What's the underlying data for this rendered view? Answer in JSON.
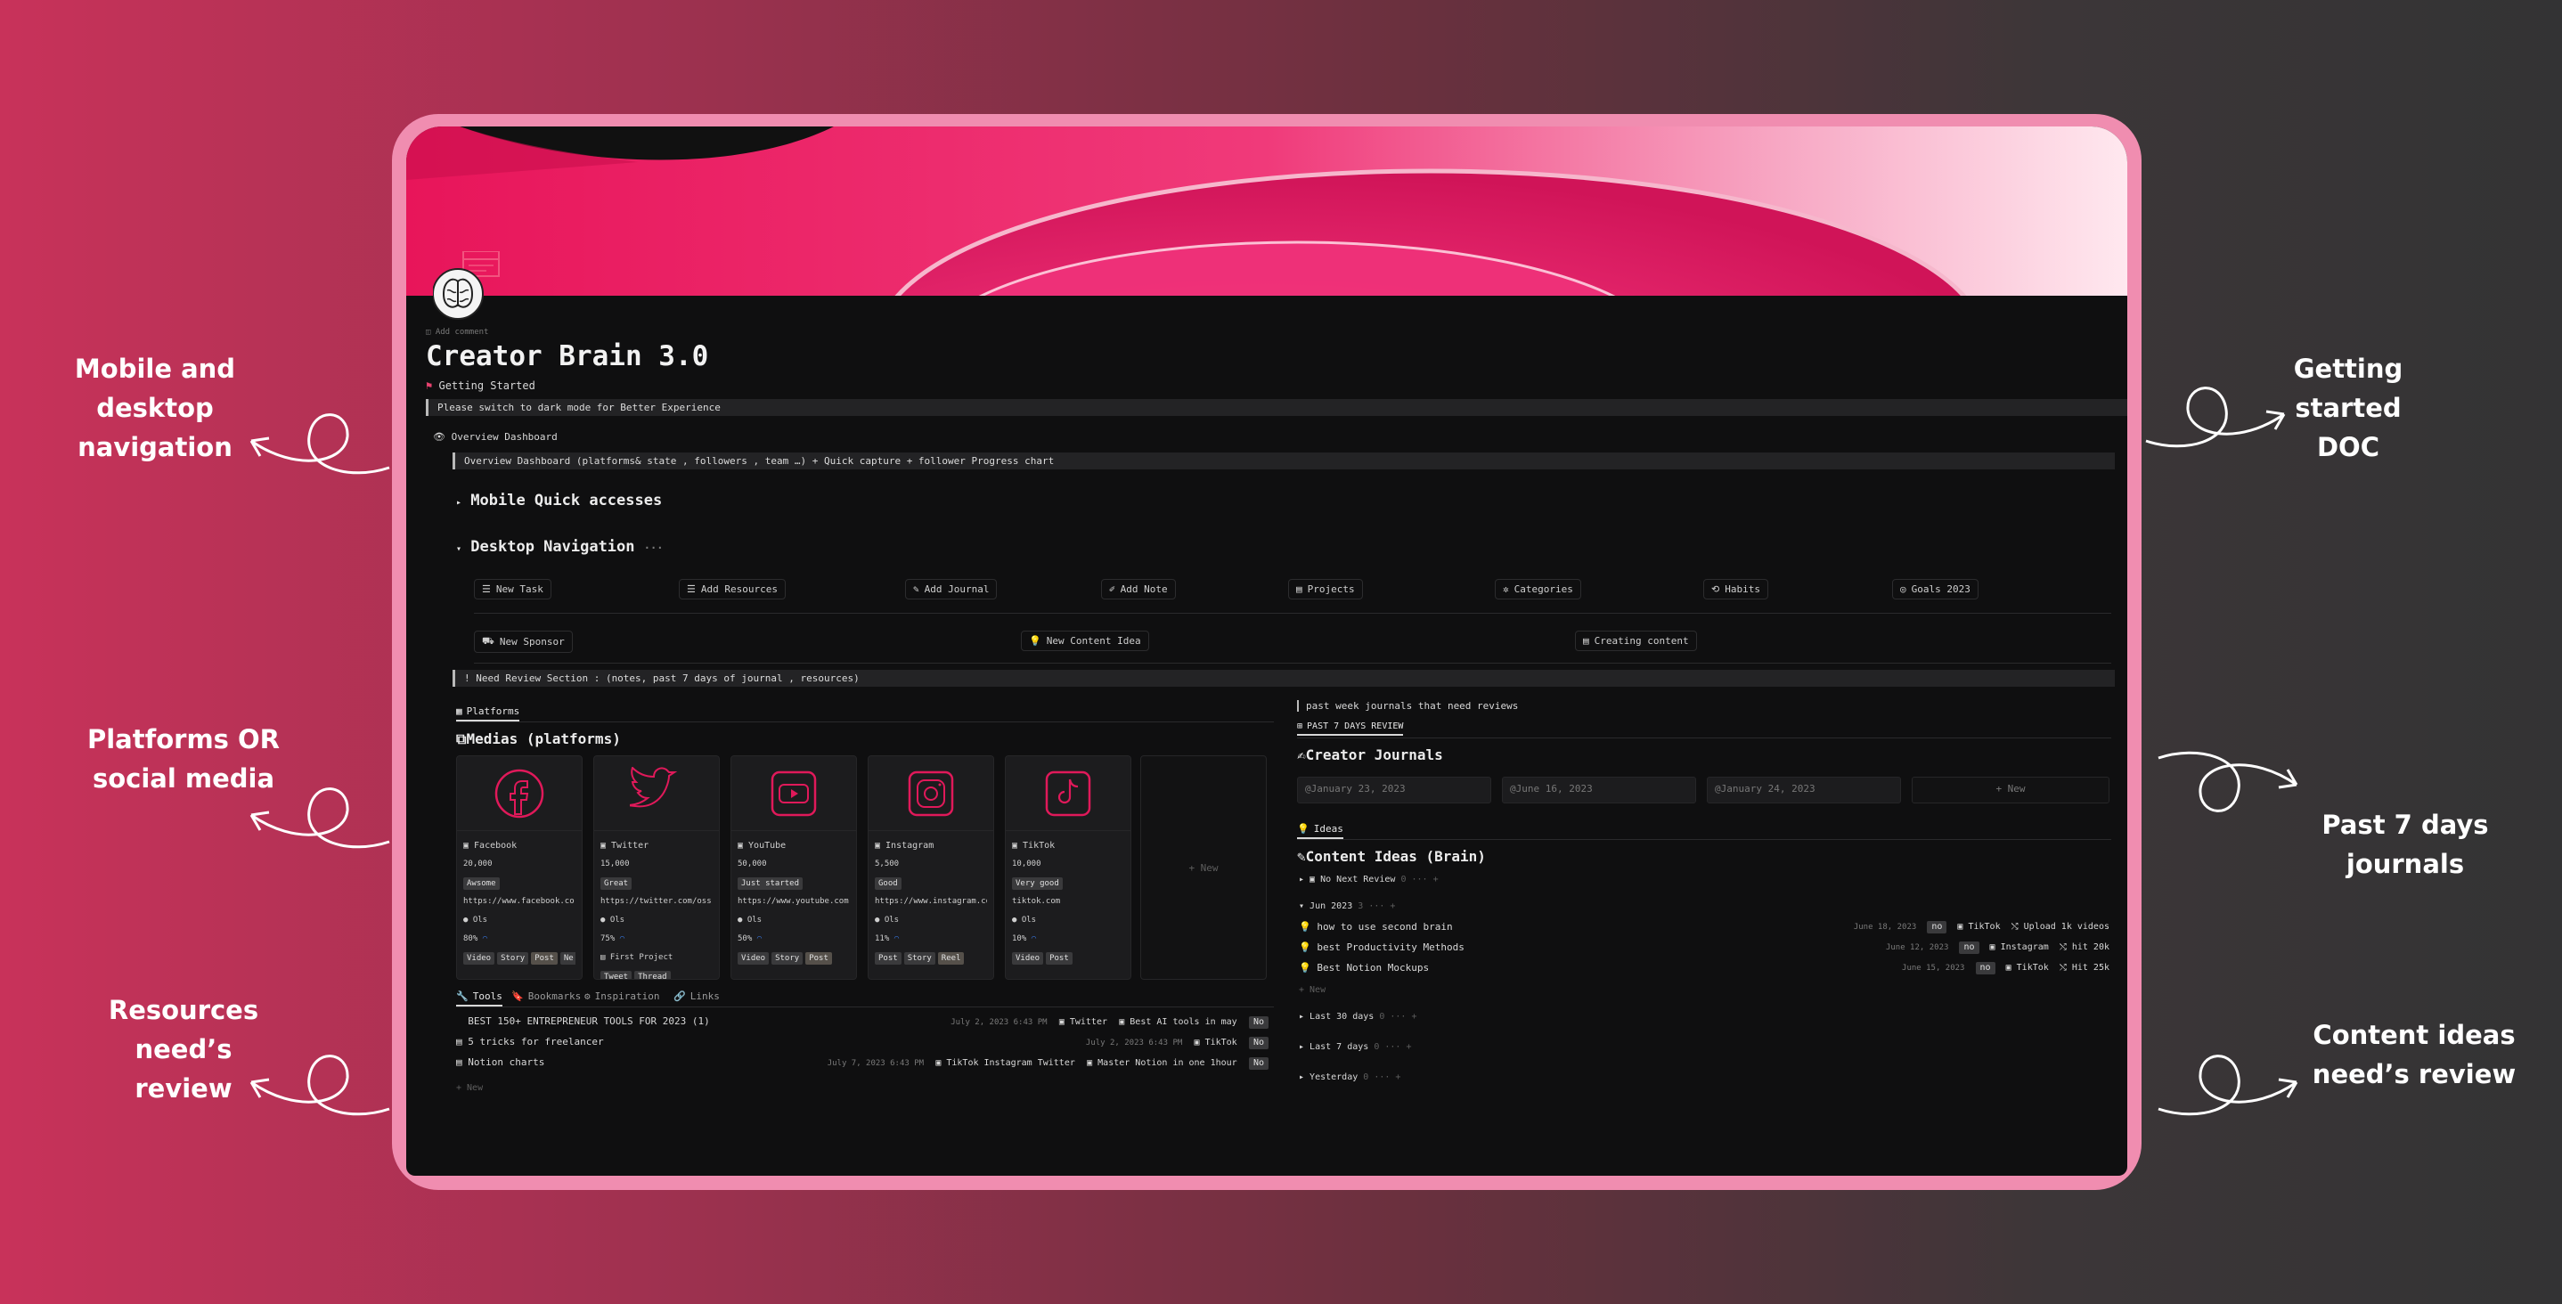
{
  "callouts": {
    "left": [
      "Mobile and\ndesktop\nnavigation",
      "Platforms OR\nsocial media",
      "Resources\nneed’s review"
    ],
    "right": [
      "Getting started\nDOC",
      "Past 7 days\njournals",
      "Content ideas\nneed’s review"
    ]
  },
  "page": {
    "add_comment": "Add comment",
    "title": "Creator Brain 3.0",
    "getting_started": "Getting Started",
    "dark_mode_note": "Please switch to dark mode for Better Experience",
    "overview_label": "Overview Dashboard",
    "overview_desc": "Overview Dashboard (platforms& state , followers , team …) + Quick capture  + follower Progress chart",
    "mobile_toggle": "Mobile Quick accesses",
    "desktop_toggle": "Desktop Navigation",
    "desktop_more": "···",
    "nav_row1": [
      "New Task",
      "Add Resources",
      "Add Journal",
      "Add Note",
      "Projects",
      "Categories",
      "Habits",
      "Goals 2023"
    ],
    "nav_row2": [
      "New Sponsor",
      "New Content Idea",
      "Creating content"
    ],
    "review_section": "! Need Review Section : (notes, past 7 days of journal , resources)"
  },
  "platforms": {
    "tab": "Platforms",
    "heading": "Medias (platforms)",
    "new_label": "+ New",
    "cards": [
      {
        "name": "Facebook",
        "followers": "20,000",
        "status": "Awsome",
        "url": "https://www.facebook.co",
        "owner": "Ols",
        "progress": "80%",
        "tags": [
          "Video",
          "Story",
          "Post",
          "Ne"
        ]
      },
      {
        "name": "Twitter",
        "followers": "15,000",
        "status": "Great",
        "url": "https://twitter.com/oss",
        "owner": "Ols",
        "progress": "75%",
        "project": "First Project",
        "tags": [
          "Tweet",
          "Thread"
        ]
      },
      {
        "name": "YouTube",
        "followers": "50,000",
        "status": "Just started",
        "url": "https://www.youtube.com",
        "owner": "Ols",
        "progress": "50%",
        "tags": [
          "Video",
          "Story",
          "Post"
        ]
      },
      {
        "name": "Instagram",
        "followers": "5,500",
        "status": "Good",
        "url": "https://www.instagram.co",
        "owner": "Ols",
        "progress": "11%",
        "tags": [
          "Post",
          "Story",
          "Reel"
        ]
      },
      {
        "name": "TikTok",
        "followers": "10,000",
        "status": "Very good",
        "url": "tiktok.com",
        "owner": "Ols",
        "progress": "10%",
        "tags": [
          "Video",
          "Post"
        ]
      }
    ],
    "colors": {
      "accent": "#e0195a"
    }
  },
  "resources": {
    "tabs": [
      "Tools",
      "Bookmarks",
      "Inspiration",
      "Links"
    ],
    "rows": [
      {
        "title": "BEST 150+ ENTREPRENEUR TOOLS FOR 2023 (1)",
        "date": "July 2, 2023 6:43 PM",
        "platforms": "Twitter",
        "note": "Best AI tools in may",
        "flag": "No"
      },
      {
        "title": "5 tricks for freelancer",
        "date": "July 2, 2023 6:43 PM",
        "platforms": "TikTok",
        "note": "",
        "flag": "No"
      },
      {
        "title": "Notion charts",
        "date": "July 7, 2023 6:43 PM",
        "platforms": "TikTok  Instagram  Twitter",
        "note": "Master Notion in one 1hour",
        "flag": "No"
      }
    ],
    "new_label": "+ New"
  },
  "journals": {
    "note": "past week journals that need reviews",
    "tab": "PAST 7 DAYS REVIEW",
    "heading": "Creator Journals",
    "entries": [
      "January 23, 2023",
      "June 16, 2023",
      "January 24, 2023"
    ],
    "new_label": "+ New"
  },
  "ideas": {
    "tab": "Ideas",
    "heading": "Content Ideas (Brain)",
    "groups": [
      {
        "label": "No Next Review",
        "count": "0"
      },
      {
        "label": "Jun 2023",
        "count": "3"
      },
      {
        "label": "Last 30 days",
        "count": "0"
      },
      {
        "label": "Last 7 days",
        "count": "0"
      },
      {
        "label": "Yesterday",
        "count": "0"
      }
    ],
    "rows": [
      {
        "title": "how to use second brain",
        "date": "June 18, 2023",
        "flag": "no",
        "platform": "TikTok",
        "goal": "Upload 1k videos"
      },
      {
        "title": "best Productivity Methods",
        "date": "June 12, 2023",
        "flag": "no",
        "platform": "Instagram",
        "goal": "hit 20k"
      },
      {
        "title": "Best Notion Mockups",
        "date": "June 15, 2023",
        "flag": "no",
        "platform": "TikTok",
        "goal": "Hit 25k"
      }
    ],
    "new_label": "+ New"
  }
}
